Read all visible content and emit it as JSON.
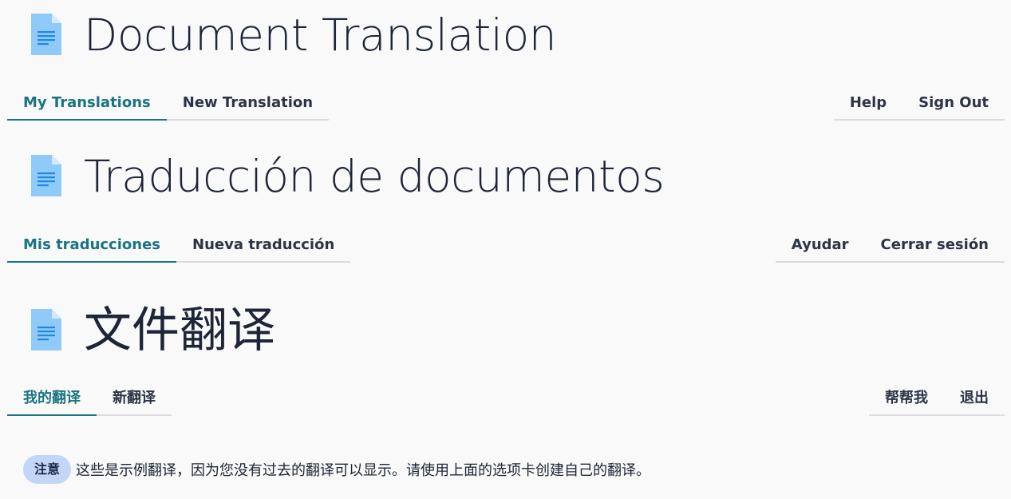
{
  "sections": [
    {
      "title": "Document Translation",
      "icon": "document-icon",
      "nav_left": [
        "My Translations",
        "New Translation"
      ],
      "nav_right": [
        "Help",
        "Sign Out"
      ],
      "active_tab": "My Translations"
    },
    {
      "title": "Traducción de documentos",
      "icon": "document-icon",
      "nav_left": [
        "Mis traducciones",
        "Nueva traducción"
      ],
      "nav_right": [
        "Ayudar",
        "Cerrar sesión"
      ],
      "active_tab": "Mis traducciones"
    },
    {
      "title": "文件翻译",
      "icon": "document-icon",
      "nav_left": [
        "我的翻译",
        "新翻译"
      ],
      "nav_right": [
        "帮帮我",
        "退出"
      ],
      "active_tab": "我的翻译"
    }
  ],
  "notice": {
    "badge": "注意",
    "text": "这些是示例翻译，因为您没有过去的翻译可以显示。请使用上面的选项卡创建自己的翻译。"
  },
  "colors": {
    "accent": "#1a7482",
    "badge_bg": "#c3d6f8",
    "icon_blue": "#90caf9",
    "icon_lines": "#1e88e5"
  }
}
